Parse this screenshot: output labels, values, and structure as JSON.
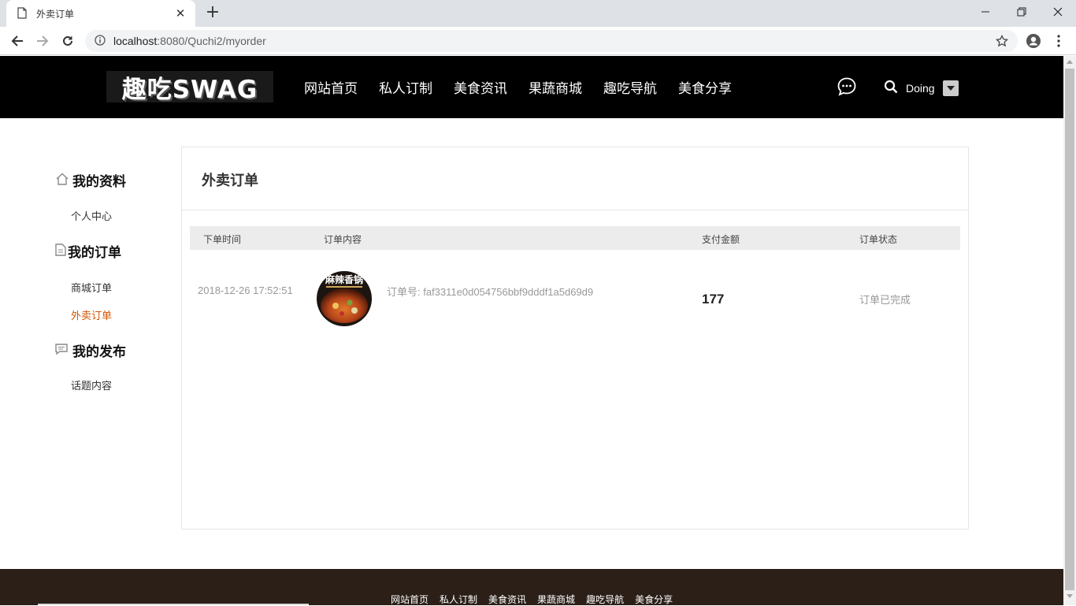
{
  "browser": {
    "tab_title": "外卖订单",
    "url_host": "localhost",
    "url_rest": ":8080/Quchi2/myorder"
  },
  "header": {
    "logo": "趣吃SWAG",
    "nav": [
      "网站首页",
      "私人订制",
      "美食资讯",
      "果蔬商城",
      "趣吃导航",
      "美食分享"
    ],
    "user_name": "Doing"
  },
  "sidebar": {
    "groups": [
      {
        "title": "我的资料",
        "icon": "home-icon",
        "items": [
          "个人中心"
        ]
      },
      {
        "title": "我的订单",
        "icon": "document-icon",
        "items": [
          "商城订单",
          "外卖订单"
        ]
      },
      {
        "title": "我的发布",
        "icon": "comment-icon",
        "items": [
          "话题内容"
        ]
      }
    ],
    "active_item": "外卖订单"
  },
  "main": {
    "title": "外卖订单",
    "columns": [
      "下单时间",
      "订单内容",
      "支付金额",
      "订单状态"
    ],
    "orders": [
      {
        "time": "2018-12-26 17:52:51",
        "thumb_text": "麻辣香锅",
        "order_no": "订单号: faf3311e0d054756bbf9dddf1a5d69d9",
        "amount": "177",
        "status": "订单已完成"
      }
    ]
  },
  "footer": {
    "nav": [
      "网站首页",
      "私人订制",
      "美食资讯",
      "果蔬商城",
      "趣吃导航",
      "美食分享"
    ]
  },
  "colors": {
    "header_bg": "#000000",
    "footer_bg": "#2b1f18",
    "active_link": "#d35400",
    "table_head_bg": "#ececec"
  }
}
